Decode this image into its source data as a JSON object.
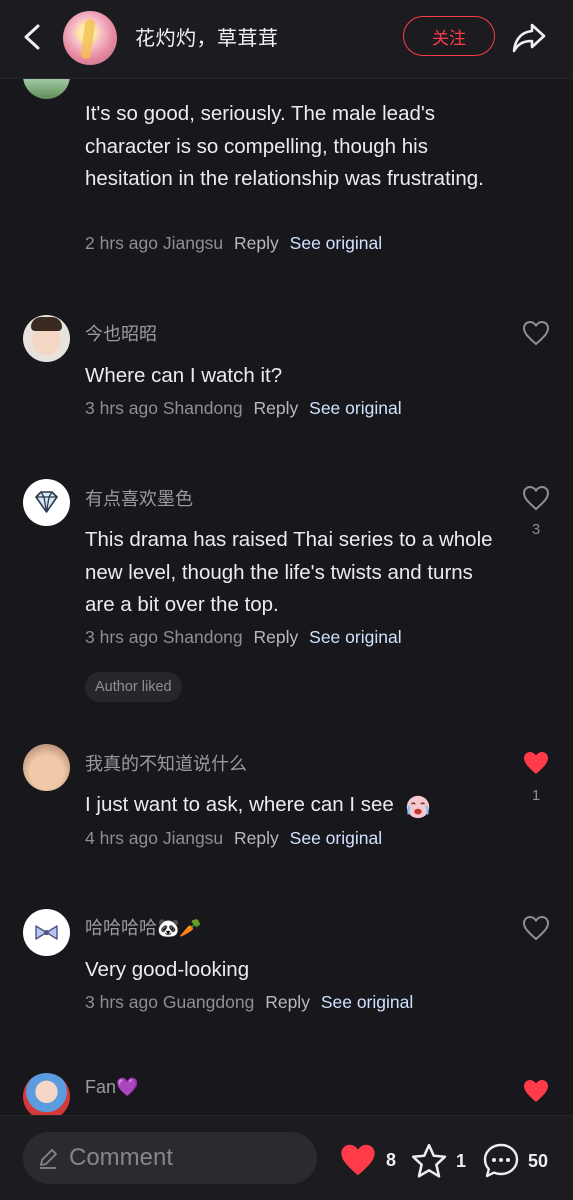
{
  "header": {
    "title": "花灼灼，草茸茸",
    "follow_label": "关注"
  },
  "comments": [
    {
      "username": "",
      "text": "It's so good, seriously. The male lead's character is so compelling, though his hesitation in the relationship was frustrating.",
      "time": "2 hrs ago",
      "location": "Jiangsu",
      "reply": "Reply",
      "see_original": "See original",
      "liked": false,
      "like_count": ""
    },
    {
      "username": "今也昭昭",
      "text": "Where can I watch it?",
      "time": "3 hrs ago",
      "location": "Shandong",
      "reply": "Reply",
      "see_original": "See original",
      "liked": false,
      "like_count": ""
    },
    {
      "username": "有点喜欢墨色",
      "text": "This drama has raised Thai series to a whole new level, though the life's twists and turns are a bit over the top.",
      "time": "3 hrs ago",
      "location": "Shandong",
      "reply": "Reply",
      "see_original": "See original",
      "liked": false,
      "like_count": "3",
      "author_liked": "Author liked"
    },
    {
      "username": "我真的不知道说什么",
      "text": "I just want to ask, where can I see",
      "time": "4 hrs ago",
      "location": "Jiangsu",
      "reply": "Reply",
      "see_original": "See original",
      "liked": true,
      "like_count": "1"
    },
    {
      "username": "哈哈哈哈🐼🥕",
      "text": "Very good-looking",
      "time": "3 hrs ago",
      "location": "Guangdong",
      "reply": "Reply",
      "see_original": "See original",
      "liked": false,
      "like_count": ""
    },
    {
      "username": "Fan💜",
      "liked": true
    }
  ],
  "bottom_bar": {
    "comment_placeholder": "Comment",
    "likes": "8",
    "favorites": "1",
    "comments": "50"
  },
  "colors": {
    "background": "#17171c",
    "accent_red": "#ff3b4a",
    "link": "#cfe2ff"
  }
}
